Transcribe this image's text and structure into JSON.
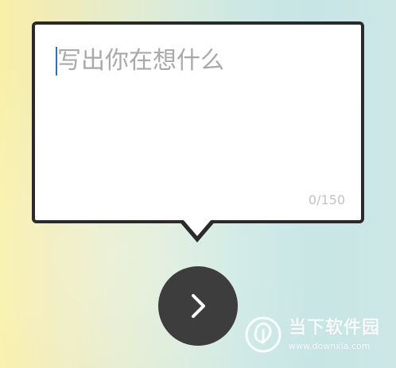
{
  "composer": {
    "placeholder": "写出你在想什么",
    "value": "",
    "counter": "0/150"
  },
  "actions": {
    "next_icon": "chevron-right-icon"
  },
  "watermark": {
    "title": "当下软件园",
    "url": "www.downxia.com"
  },
  "colors": {
    "bubble_border": "#2a2a2a",
    "button_bg": "#3d3d3d",
    "caret": "#2b6fd6",
    "placeholder": "#a9a9a9"
  }
}
